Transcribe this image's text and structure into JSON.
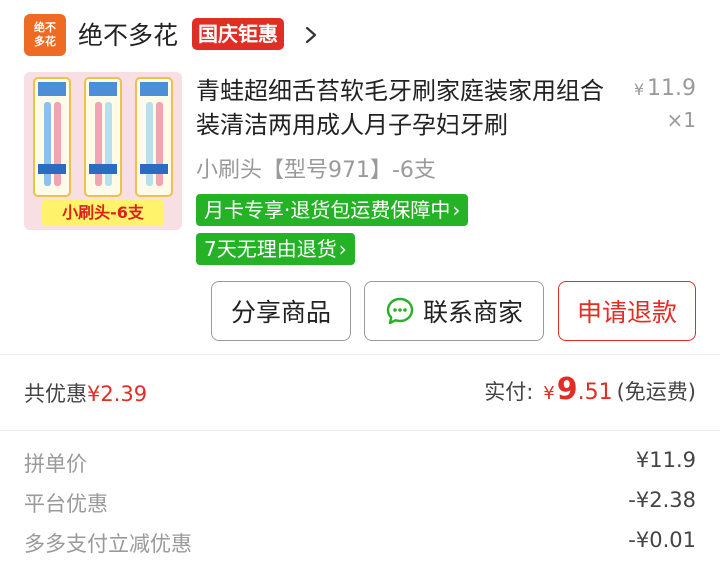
{
  "shop": {
    "logo_line1": "绝不",
    "logo_line2": "多花",
    "name": "绝不多花",
    "badge": "国庆钜惠"
  },
  "product": {
    "title": "青蛙超细舌苔软毛牙刷家庭装家用组合装清洁两用成人月子孕妇牙刷",
    "image_caption": "小刷头-6支",
    "unit_price_symbol": "¥",
    "unit_price": "11.9",
    "quantity": "×1",
    "spec": "小刷头【型号971】-6支",
    "promos": [
      "月卡专享·退货包运费保障中",
      "7天无理由退货"
    ],
    "promo_chevron": "›"
  },
  "actions": {
    "share_label": "分享商品",
    "contact_label": "联系商家",
    "refund_label": "申请退款"
  },
  "summary": {
    "discount_label": "共优惠",
    "discount_value": "¥2.39",
    "paid_label": "实付:",
    "paid_symbol": "¥",
    "paid_integer": "9",
    "paid_decimal": ".51",
    "paid_note": "(免运费)"
  },
  "details": [
    {
      "label": "拼单价",
      "value": "¥11.9"
    },
    {
      "label": "平台优惠",
      "value": "-¥2.38"
    },
    {
      "label": "多多支付立减优惠",
      "value": "-¥0.01"
    }
  ],
  "colors": {
    "brand_red": "#e02e24",
    "promo_green": "#25b226",
    "shop_logo_orange": "#ef6a23"
  }
}
